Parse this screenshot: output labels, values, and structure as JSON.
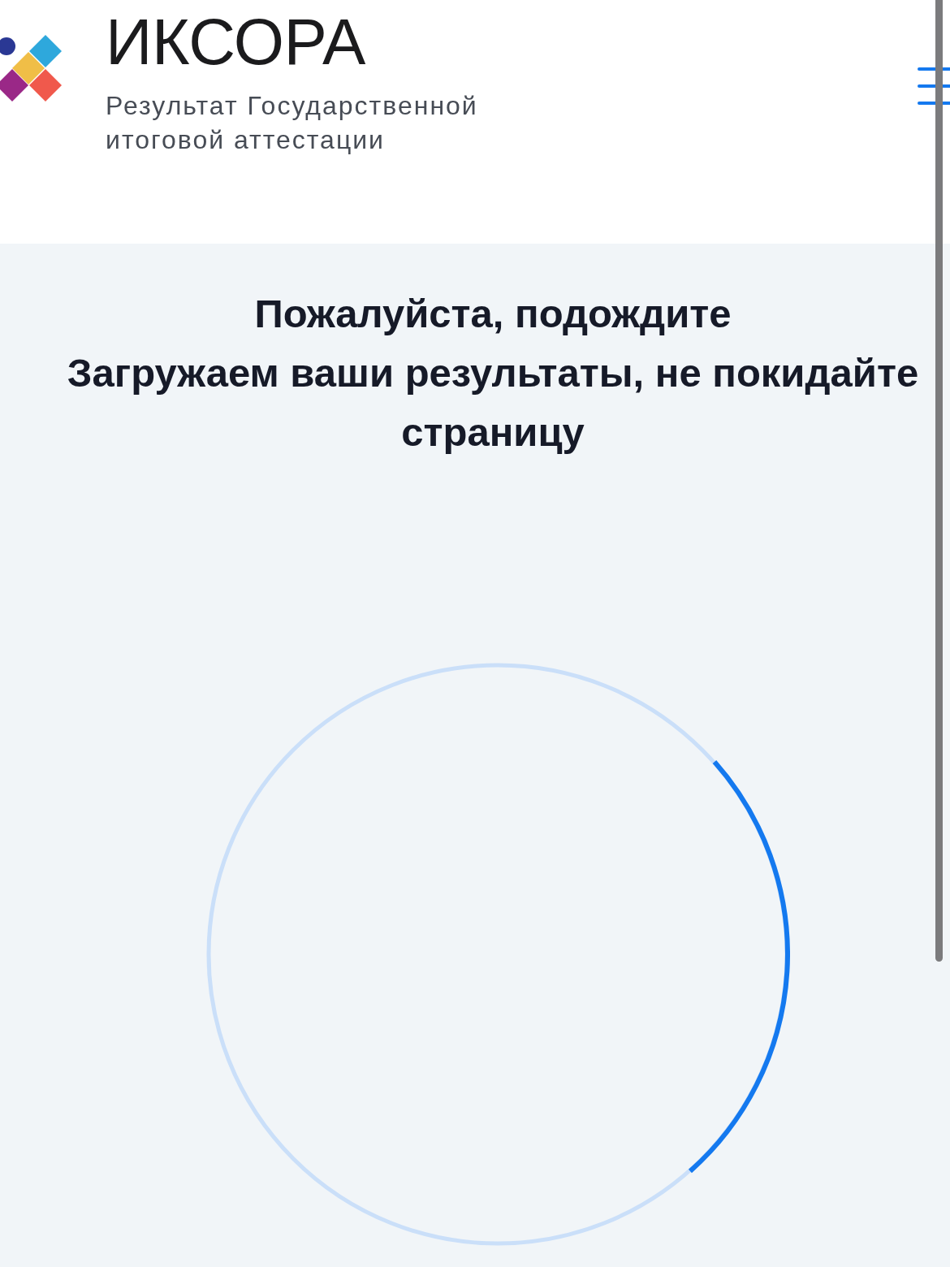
{
  "header": {
    "logo_title": "ИКСОРА",
    "logo_subtitle": "Результат Государственной итоговой аттестации"
  },
  "loading": {
    "title": "Пожалуйста, подождите",
    "message": "Загружаем ваши результаты, не покидайте страницу"
  }
}
